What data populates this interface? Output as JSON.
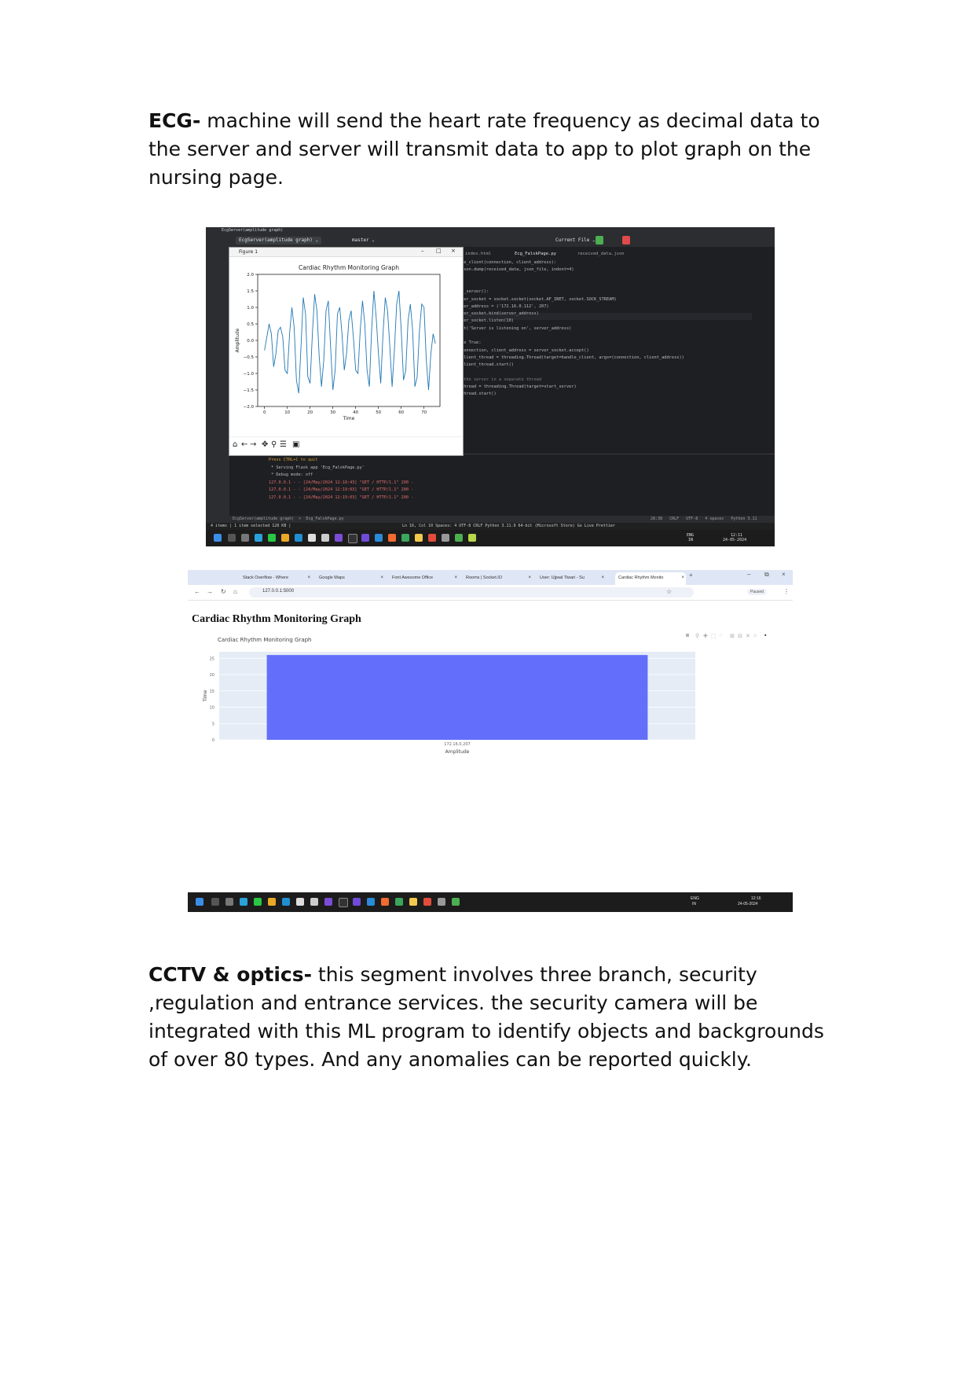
{
  "paragraphs": {
    "ecg_label": "ECG-",
    "ecg_text": " machine will send the heart rate frequency as decimal data to the server and server will transmit data to app to plot graph on the nursing page.",
    "cctv_label": "CCTV & optics-",
    "cctv_text": " this segment involves three branch, security ,regulation and entrance services. the security camera will be integrated with this ML program to identify objects and backgrounds of over 80 types. And any anomalies can be reported quickly."
  },
  "ide": {
    "window_title": "EcgServer(amplitude graph)",
    "project_label": "EcgServer(amplitude graph) ⌄",
    "branch_label": "master ⌄",
    "current_file": "Current File ⌄",
    "tabs": [
      "index.html",
      "Ecg_FalskPage.py",
      "received_data.json"
    ],
    "code_lines": [
      "le_client(connection, client_address):",
      "json.dump(received_data, json_file, indent=4)",
      "",
      "",
      "t_server():",
      "ver_socket = socket.socket(socket.AF_INET, socket.SOCK_STREAM)",
      "ver_address = ('172.16.0.112', 207)",
      "ver_socket.bind(server_address)",
      "ver_socket.listen(10)",
      "nt('Server is listening on', server_address)",
      "",
      "le True:",
      "connection, client_address = server_socket.accept()",
      "client_thread = threading.Thread(target=handle_client, args=(connection, client_address))",
      "client_thread.start()",
      "",
      " the server in a separate thread",
      "thread = threading.Thread(target=start_server)",
      "thread.start()"
    ],
    "terminal_lines": [
      "Press CTRL+C to quit",
      " * Serving Flask app 'Ecg_FalskPage.py'",
      " * Debug mode: off",
      "127.0.0.1 - - [24/May/2024 12:18:43] \"GET / HTTP/1.1\" 200 -",
      "127.0.0.1 - - [24/May/2024 12:19:03] \"GET / HTTP/1.1\" 200 -",
      "127.0.0.1 - - [24/May/2024 12:19:03] \"GET / HTTP/1.1\" 200 -"
    ],
    "breadcrumb": "EcgServer(amplitude graph)  >  Ecg_FalskPage.py",
    "status_right": "28:38   CRLF   UTF-8   4 spaces   Python 3.11",
    "explorer_status": "4 items  |  1 item selected  128 KB  |",
    "vscode_status": "Ln 16, Col 10   Spaces: 4   UTF-8   CRLF   Python   3.11.9 64-bit (Microsoft Store)   Go Live   Prettier",
    "taskbar_time": "12:11",
    "taskbar_date": "24-05-2024",
    "taskbar_lang": "ENG",
    "taskbar_region": "IN"
  },
  "figure": {
    "window_title": "Figure 1",
    "toolbar_icons": [
      "home-icon",
      "back-icon",
      "forward-icon",
      "pan-icon",
      "zoom-icon",
      "configure-icon",
      "save-icon"
    ]
  },
  "browser": {
    "tabs": [
      "Stack Overflow - Where",
      "Google Maps",
      "Font Awesome Office",
      "Rooms | Socket.IO",
      "User: Ujjwal Tiwari - Su",
      "Cardiac Rhythm Monito"
    ],
    "url": "127.0.0.1:5000",
    "profile": "Paused",
    "page_heading": "Cardiac Rhythm Monitoring Graph",
    "taskbar_time": "12:16",
    "taskbar_date": "24-05-2024",
    "taskbar_lang": "ENG",
    "taskbar_region": "IN"
  },
  "chart_data": [
    {
      "type": "line",
      "title": "Cardiac Rhythm Monitoring Graph",
      "xlabel": "Time",
      "ylabel": "Amplitude",
      "xlim": [
        -3,
        77
      ],
      "ylim": [
        -2.0,
        2.0
      ],
      "xticks": [
        0,
        10,
        20,
        30,
        40,
        50,
        60,
        70
      ],
      "yticks": [
        -2.0,
        -1.5,
        -1.0,
        -0.5,
        0.0,
        0.5,
        1.0,
        1.5,
        2.0
      ],
      "ytick_labels": [
        "−2.0",
        "−1.5",
        "−1.0",
        "−0.5",
        "0.0",
        "0.5",
        "1.0",
        "1.5",
        "2.0"
      ],
      "grid": false,
      "color": "#1f77b4",
      "x": [
        0,
        1,
        2,
        3,
        4,
        5,
        6,
        7,
        8,
        9,
        10,
        11,
        12,
        13,
        14,
        15,
        16,
        17,
        18,
        19,
        20,
        21,
        22,
        23,
        24,
        25,
        26,
        27,
        28,
        29,
        30,
        31,
        32,
        33,
        34,
        35,
        36,
        37,
        38,
        39,
        40,
        41,
        42,
        43,
        44,
        45,
        46,
        47,
        48,
        49,
        50,
        51,
        52,
        53,
        54,
        55,
        56,
        57,
        58,
        59,
        60,
        61,
        62,
        63,
        64,
        65,
        66,
        67,
        68,
        69,
        70,
        71,
        72,
        73,
        74,
        75
      ],
      "y": [
        -0.3,
        0.1,
        0.5,
        0.2,
        -0.8,
        -0.4,
        0.3,
        0.4,
        0.1,
        -0.9,
        -1.0,
        0.2,
        1.0,
        0.4,
        -1.2,
        -1.6,
        -0.2,
        1.3,
        0.8,
        -1.1,
        -1.3,
        0.2,
        1.4,
        0.9,
        -0.5,
        -1.4,
        -0.6,
        0.9,
        1.2,
        -0.2,
        -1.5,
        -0.9,
        0.8,
        1.0,
        0.2,
        -0.9,
        -0.4,
        0.6,
        0.9,
        0.1,
        -0.9,
        -1.0,
        0.3,
        1.2,
        0.5,
        -0.9,
        -1.4,
        0.3,
        1.5,
        0.7,
        -0.4,
        -1.3,
        0.2,
        1.3,
        0.9,
        -0.2,
        -1.4,
        -0.3,
        1.1,
        1.5,
        0.3,
        -1.2,
        -0.9,
        0.6,
        1.1,
        0.3,
        -1.4,
        -1.1,
        0.3,
        1.1,
        1.0,
        -0.6,
        -1.5,
        -0.4,
        0.2,
        -0.1
      ]
    },
    {
      "type": "bar",
      "title": "Cardiac Rhythm Monitoring Graph",
      "xlabel": "Amplitude",
      "ylabel": "Time",
      "categories": [
        "172.16.0.207"
      ],
      "values": [
        26
      ],
      "ylim": [
        0,
        27
      ],
      "yticks": [
        0,
        5,
        10,
        15,
        20,
        25
      ],
      "color": "#636efa",
      "plot_bg": "#e5ecf6",
      "grid": true
    }
  ]
}
